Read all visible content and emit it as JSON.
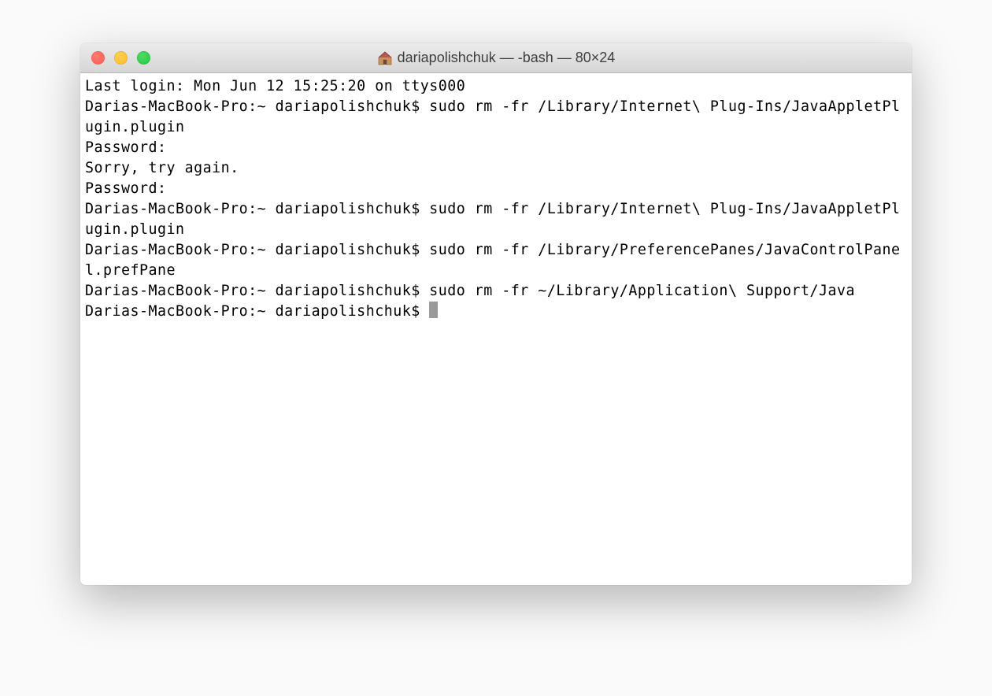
{
  "window": {
    "title": "dariapolishchuk — -bash — 80×24"
  },
  "terminal": {
    "lines": [
      "Last login: Mon Jun 12 15:25:20 on ttys000",
      "Darias-MacBook-Pro:~ dariapolishchuk$ sudo rm -fr /Library/Internet\\ Plug-Ins/JavaAppletPlugin.plugin",
      "Password:",
      "Sorry, try again.",
      "Password:",
      "Darias-MacBook-Pro:~ dariapolishchuk$ sudo rm -fr /Library/Internet\\ Plug-Ins/JavaAppletPlugin.plugin",
      "Darias-MacBook-Pro:~ dariapolishchuk$ sudo rm -fr /Library/PreferencePanes/JavaControlPanel.prefPane",
      "Darias-MacBook-Pro:~ dariapolishchuk$ sudo rm -fr ~/Library/Application\\ Support/Java",
      "Darias-MacBook-Pro:~ dariapolishchuk$ "
    ]
  }
}
